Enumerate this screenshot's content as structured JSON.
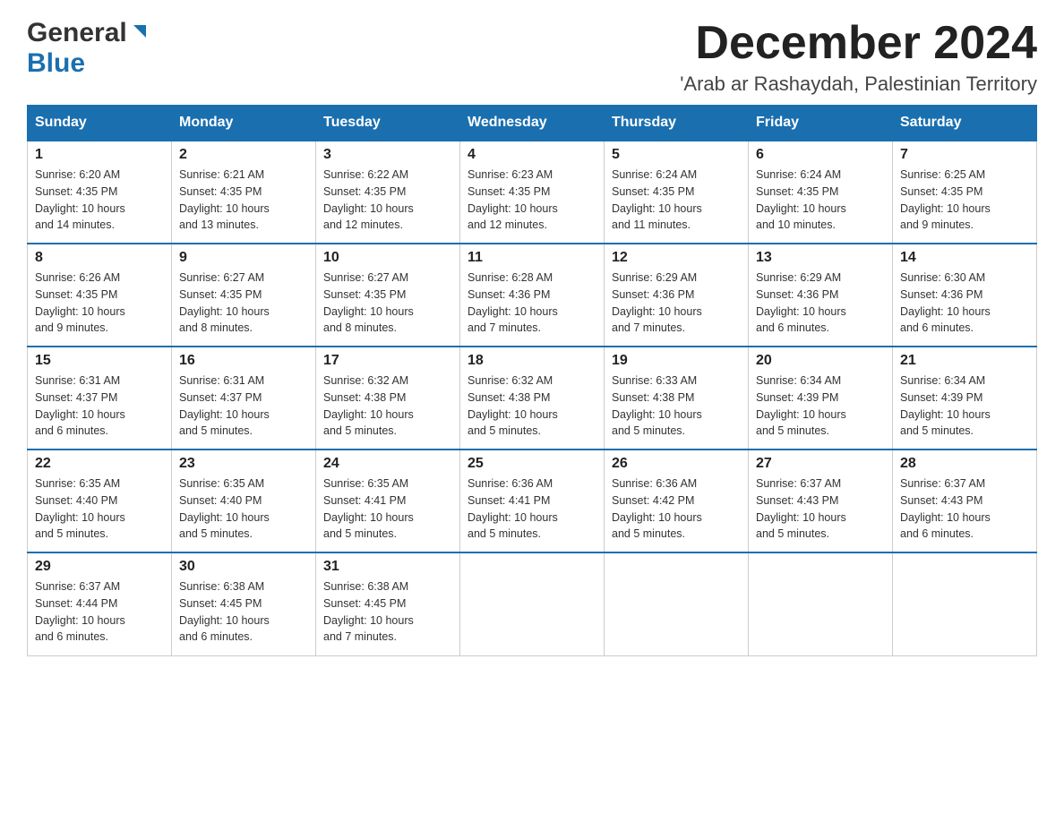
{
  "header": {
    "logo_general": "General",
    "logo_blue": "Blue",
    "month_year": "December 2024",
    "location": "'Arab ar Rashaydah, Palestinian Territory"
  },
  "weekdays": [
    "Sunday",
    "Monday",
    "Tuesday",
    "Wednesday",
    "Thursday",
    "Friday",
    "Saturday"
  ],
  "weeks": [
    [
      {
        "day": "1",
        "sunrise": "6:20 AM",
        "sunset": "4:35 PM",
        "daylight": "10 hours and 14 minutes."
      },
      {
        "day": "2",
        "sunrise": "6:21 AM",
        "sunset": "4:35 PM",
        "daylight": "10 hours and 13 minutes."
      },
      {
        "day": "3",
        "sunrise": "6:22 AM",
        "sunset": "4:35 PM",
        "daylight": "10 hours and 12 minutes."
      },
      {
        "day": "4",
        "sunrise": "6:23 AM",
        "sunset": "4:35 PM",
        "daylight": "10 hours and 12 minutes."
      },
      {
        "day": "5",
        "sunrise": "6:24 AM",
        "sunset": "4:35 PM",
        "daylight": "10 hours and 11 minutes."
      },
      {
        "day": "6",
        "sunrise": "6:24 AM",
        "sunset": "4:35 PM",
        "daylight": "10 hours and 10 minutes."
      },
      {
        "day": "7",
        "sunrise": "6:25 AM",
        "sunset": "4:35 PM",
        "daylight": "10 hours and 9 minutes."
      }
    ],
    [
      {
        "day": "8",
        "sunrise": "6:26 AM",
        "sunset": "4:35 PM",
        "daylight": "10 hours and 9 minutes."
      },
      {
        "day": "9",
        "sunrise": "6:27 AM",
        "sunset": "4:35 PM",
        "daylight": "10 hours and 8 minutes."
      },
      {
        "day": "10",
        "sunrise": "6:27 AM",
        "sunset": "4:35 PM",
        "daylight": "10 hours and 8 minutes."
      },
      {
        "day": "11",
        "sunrise": "6:28 AM",
        "sunset": "4:36 PM",
        "daylight": "10 hours and 7 minutes."
      },
      {
        "day": "12",
        "sunrise": "6:29 AM",
        "sunset": "4:36 PM",
        "daylight": "10 hours and 7 minutes."
      },
      {
        "day": "13",
        "sunrise": "6:29 AM",
        "sunset": "4:36 PM",
        "daylight": "10 hours and 6 minutes."
      },
      {
        "day": "14",
        "sunrise": "6:30 AM",
        "sunset": "4:36 PM",
        "daylight": "10 hours and 6 minutes."
      }
    ],
    [
      {
        "day": "15",
        "sunrise": "6:31 AM",
        "sunset": "4:37 PM",
        "daylight": "10 hours and 6 minutes."
      },
      {
        "day": "16",
        "sunrise": "6:31 AM",
        "sunset": "4:37 PM",
        "daylight": "10 hours and 5 minutes."
      },
      {
        "day": "17",
        "sunrise": "6:32 AM",
        "sunset": "4:38 PM",
        "daylight": "10 hours and 5 minutes."
      },
      {
        "day": "18",
        "sunrise": "6:32 AM",
        "sunset": "4:38 PM",
        "daylight": "10 hours and 5 minutes."
      },
      {
        "day": "19",
        "sunrise": "6:33 AM",
        "sunset": "4:38 PM",
        "daylight": "10 hours and 5 minutes."
      },
      {
        "day": "20",
        "sunrise": "6:34 AM",
        "sunset": "4:39 PM",
        "daylight": "10 hours and 5 minutes."
      },
      {
        "day": "21",
        "sunrise": "6:34 AM",
        "sunset": "4:39 PM",
        "daylight": "10 hours and 5 minutes."
      }
    ],
    [
      {
        "day": "22",
        "sunrise": "6:35 AM",
        "sunset": "4:40 PM",
        "daylight": "10 hours and 5 minutes."
      },
      {
        "day": "23",
        "sunrise": "6:35 AM",
        "sunset": "4:40 PM",
        "daylight": "10 hours and 5 minutes."
      },
      {
        "day": "24",
        "sunrise": "6:35 AM",
        "sunset": "4:41 PM",
        "daylight": "10 hours and 5 minutes."
      },
      {
        "day": "25",
        "sunrise": "6:36 AM",
        "sunset": "4:41 PM",
        "daylight": "10 hours and 5 minutes."
      },
      {
        "day": "26",
        "sunrise": "6:36 AM",
        "sunset": "4:42 PM",
        "daylight": "10 hours and 5 minutes."
      },
      {
        "day": "27",
        "sunrise": "6:37 AM",
        "sunset": "4:43 PM",
        "daylight": "10 hours and 5 minutes."
      },
      {
        "day": "28",
        "sunrise": "6:37 AM",
        "sunset": "4:43 PM",
        "daylight": "10 hours and 6 minutes."
      }
    ],
    [
      {
        "day": "29",
        "sunrise": "6:37 AM",
        "sunset": "4:44 PM",
        "daylight": "10 hours and 6 minutes."
      },
      {
        "day": "30",
        "sunrise": "6:38 AM",
        "sunset": "4:45 PM",
        "daylight": "10 hours and 6 minutes."
      },
      {
        "day": "31",
        "sunrise": "6:38 AM",
        "sunset": "4:45 PM",
        "daylight": "10 hours and 7 minutes."
      },
      null,
      null,
      null,
      null
    ]
  ]
}
